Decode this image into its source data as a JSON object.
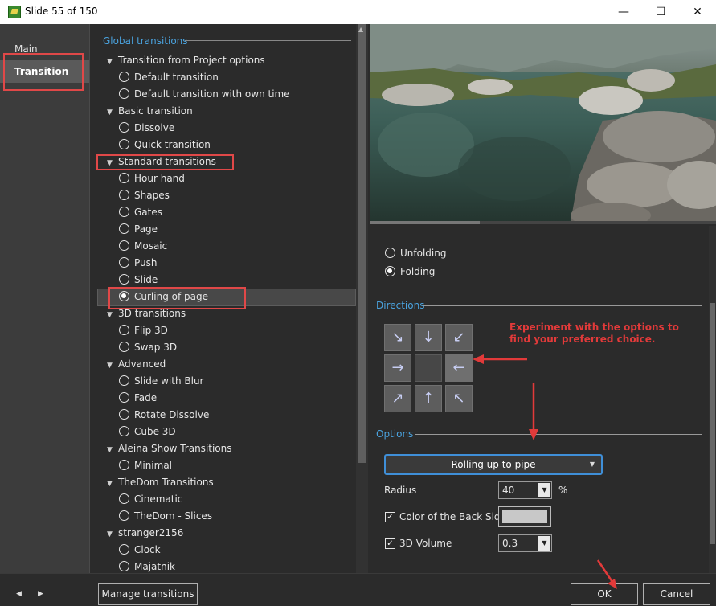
{
  "window": {
    "title": "Slide 55 of 150",
    "minimize": "—",
    "maximize": "☐",
    "close": "✕"
  },
  "nav": {
    "items": [
      {
        "label": "Main",
        "active": false
      },
      {
        "label": "Transition",
        "active": true
      }
    ]
  },
  "tree": {
    "section_title": "Global transitions",
    "nodes": [
      {
        "type": "group",
        "label": "Transition from Project options"
      },
      {
        "type": "item",
        "label": "Default transition",
        "selected": false
      },
      {
        "type": "item",
        "label": "Default transition with own time",
        "selected": false
      },
      {
        "type": "group",
        "label": "Basic transition"
      },
      {
        "type": "item",
        "label": "Dissolve",
        "selected": false
      },
      {
        "type": "item",
        "label": "Quick transition",
        "selected": false
      },
      {
        "type": "group",
        "label": "Standard transitions"
      },
      {
        "type": "item",
        "label": "Hour hand",
        "selected": false
      },
      {
        "type": "item",
        "label": "Shapes",
        "selected": false
      },
      {
        "type": "item",
        "label": "Gates",
        "selected": false
      },
      {
        "type": "item",
        "label": "Page",
        "selected": false
      },
      {
        "type": "item",
        "label": "Mosaic",
        "selected": false
      },
      {
        "type": "item",
        "label": "Push",
        "selected": false
      },
      {
        "type": "item",
        "label": "Slide",
        "selected": false
      },
      {
        "type": "item",
        "label": "Curling of page",
        "selected": true
      },
      {
        "type": "group",
        "label": "3D transitions"
      },
      {
        "type": "item",
        "label": "Flip 3D",
        "selected": false
      },
      {
        "type": "item",
        "label": "Swap 3D",
        "selected": false
      },
      {
        "type": "group",
        "label": "Advanced"
      },
      {
        "type": "item",
        "label": "Slide with Blur",
        "selected": false
      },
      {
        "type": "item",
        "label": "Fade",
        "selected": false
      },
      {
        "type": "item",
        "label": "Rotate Dissolve",
        "selected": false
      },
      {
        "type": "item",
        "label": "Cube 3D",
        "selected": false
      },
      {
        "type": "group",
        "label": "Aleina Show Transitions"
      },
      {
        "type": "item",
        "label": "Minimal",
        "selected": false
      },
      {
        "type": "group",
        "label": "TheDom Transitions"
      },
      {
        "type": "item",
        "label": "Cinematic",
        "selected": false
      },
      {
        "type": "item",
        "label": "TheDom - Slices",
        "selected": false
      },
      {
        "type": "group",
        "label": "stranger2156"
      },
      {
        "type": "item",
        "label": "Clock",
        "selected": false
      },
      {
        "type": "item",
        "label": "Majatnik",
        "selected": false
      }
    ]
  },
  "settings": {
    "mode_options": [
      {
        "label": "Unfolding",
        "selected": false
      },
      {
        "label": "Folding",
        "selected": true
      }
    ],
    "directions_title": "Directions",
    "directions": [
      "↘",
      "↓",
      "↙",
      "→",
      "",
      "←",
      "↗",
      "↑",
      "↖"
    ],
    "selected_direction": "←",
    "annotation": "Experiment with the options to find your preferred choice.",
    "options_title": "Options",
    "effect": "Rolling up to pipe",
    "radius_label": "Radius",
    "radius_value": "40",
    "radius_unit": "%",
    "back_color_label": "Color of the Back Side",
    "back_color_checked": true,
    "back_color": "#c8c8c8",
    "volume_label": "3D Volume",
    "volume_checked": true,
    "volume_value": "0.3"
  },
  "footer": {
    "manage_label": "Manage transitions",
    "ok_label": "OK",
    "cancel_label": "Cancel",
    "prev_icon": "◀",
    "next_icon": "▶"
  },
  "colors": {
    "accent_blue": "#4aa3df",
    "highlight_red": "#e04848",
    "annotation_red": "#e23a3a"
  }
}
